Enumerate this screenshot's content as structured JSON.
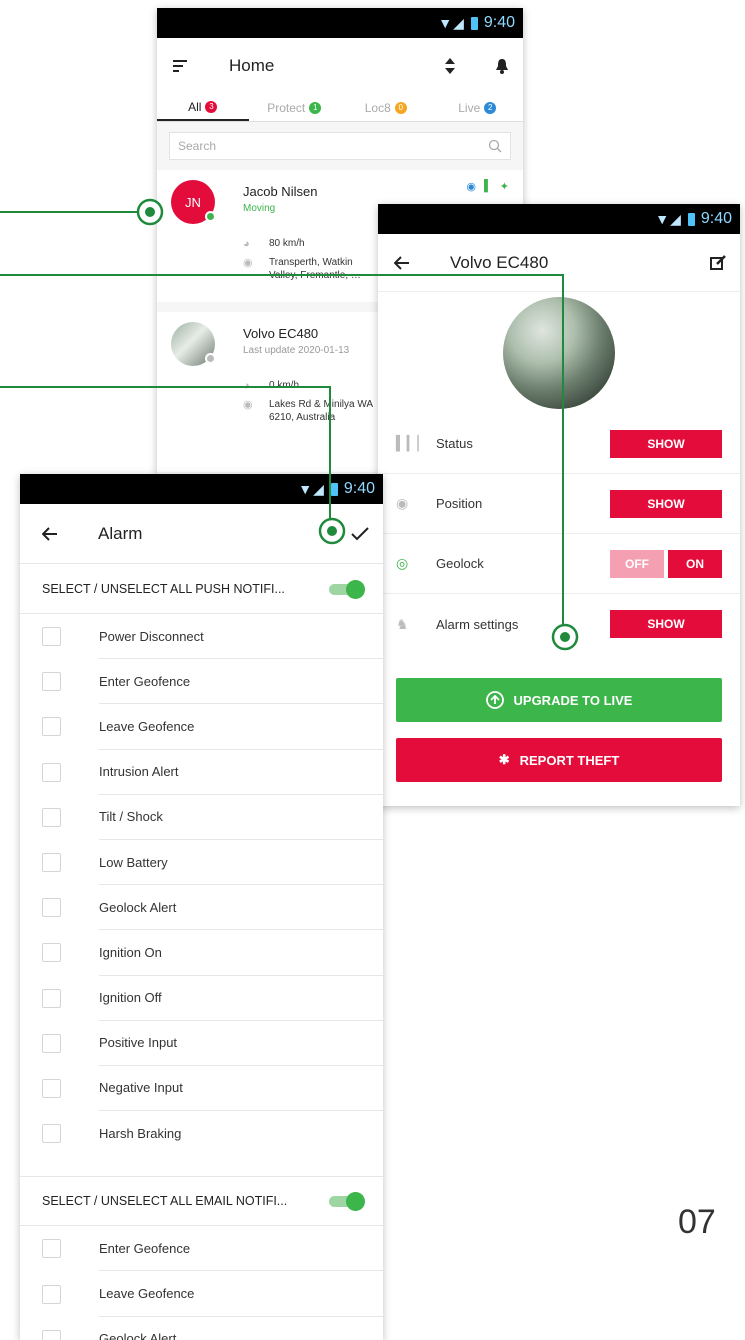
{
  "status_time": "9:40",
  "home": {
    "title": "Home",
    "tabs": [
      {
        "label": "All",
        "count": "3",
        "color": "#e30c3b"
      },
      {
        "label": "Protect",
        "count": "1",
        "color": "#3cb54a"
      },
      {
        "label": "Loc8",
        "count": "0",
        "color": "#f5a623"
      },
      {
        "label": "Live",
        "count": "2",
        "color": "#2a8ad8"
      }
    ],
    "search_placeholder": "Search",
    "cards": [
      {
        "initials": "JN",
        "name": "Jacob Nilsen",
        "status": "Moving",
        "speed": "80 km/h",
        "address": "Transperth, Watkin Valley, Fremantle, …"
      },
      {
        "name": "Volvo EC480",
        "status": "Last update 2020-01-13",
        "speed": "0 km/h",
        "address": "Lakes Rd & Minilya WA 6210, Australia"
      }
    ]
  },
  "detail": {
    "title": "Volvo EC480",
    "rows": [
      {
        "label": "Status",
        "action": "SHOW"
      },
      {
        "label": "Position",
        "action": "SHOW"
      },
      {
        "label": "Geolock",
        "off": "OFF",
        "on": "ON"
      },
      {
        "label": "Alarm settings",
        "action": "SHOW"
      }
    ],
    "upgrade_label": "UPGRADE TO LIVE",
    "report_label": "REPORT THEFT",
    "colors": {
      "red": "#e30c3b",
      "green": "#3cb54a"
    }
  },
  "alarm": {
    "title": "Alarm",
    "push_section": "SELECT / UNSELECT ALL PUSH NOTIFI...",
    "push_items": [
      "Power Disconnect",
      "Enter Geofence",
      "Leave Geofence",
      "Intrusion Alert",
      "Tilt / Shock",
      "Low Battery",
      "Geolock Alert",
      "Ignition On",
      "Ignition Off",
      "Positive Input",
      "Negative Input",
      "Harsh Braking"
    ],
    "email_section": "SELECT / UNSELECT ALL EMAIL NOTIFI...",
    "email_items": [
      "Enter Geofence",
      "Leave Geofence",
      "Geolock Alert"
    ]
  },
  "page_number": "07"
}
